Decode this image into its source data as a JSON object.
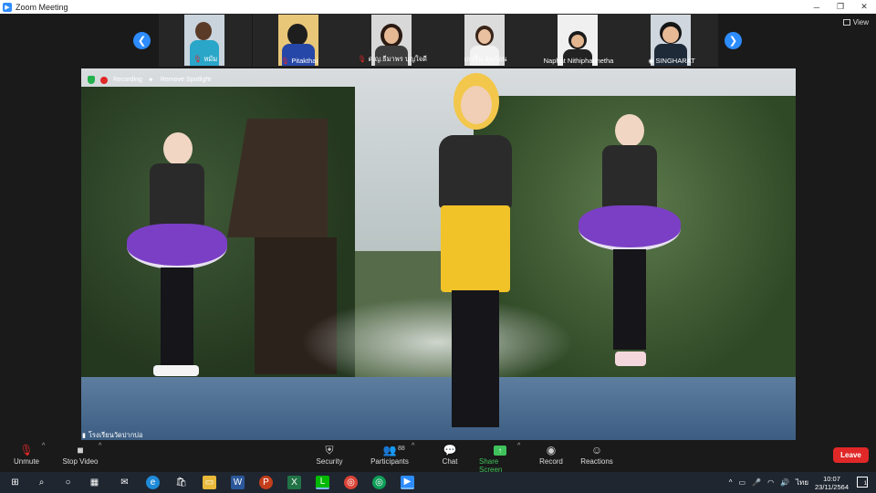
{
  "window": {
    "title": "Zoom Meeting"
  },
  "view_label": "View",
  "participants_strip": [
    {
      "name": "หม้ม",
      "muted": true,
      "shirt": "#2aa6c9",
      "bg": "#c9d4dd"
    },
    {
      "name": "Pitakthai",
      "muted": true,
      "shirt": "#2747a8",
      "bg": "#e9c778"
    },
    {
      "name": "ด.ญ.ธีมาพร บุญใจดี",
      "muted": true,
      "shirt": "#3d3d3d",
      "bg": "#d8d8d8"
    },
    {
      "name": "เกวริน ฉุ่มก่อน",
      "muted": false,
      "shirt": "#f2f2f2",
      "bg": "#dcdcdc"
    },
    {
      "name": "Naphat Nithiphatmetha",
      "muted": false,
      "shirt": "#222222",
      "bg": "#f0f0f0"
    },
    {
      "name": "SINGHARAT",
      "muted": false,
      "shirt": "#1e2a38",
      "bg": "#cfd6de"
    }
  ],
  "video_overlay": {
    "recording_label": "Recording",
    "remove_spotlight_label": "Remove Spotlight",
    "speaker_name": "โรงเรียนวัดปากบ่อ"
  },
  "toolbar": {
    "unmute": "Unmute",
    "stop_video": "Stop Video",
    "security": "Security",
    "participants": "Participants",
    "participants_count": "88",
    "chat": "Chat",
    "share_screen": "Share Screen",
    "record": "Record",
    "reactions": "Reactions",
    "leave": "Leave"
  },
  "taskbar": {
    "language": "ไทย",
    "time": "10:07",
    "date": "23/11/2564",
    "notification_count": "1"
  }
}
